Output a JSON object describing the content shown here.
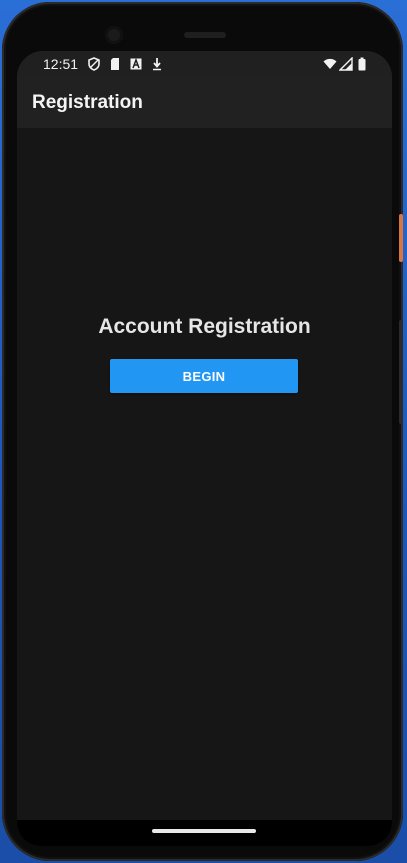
{
  "status_bar": {
    "time": "12:51",
    "left_icons": [
      "shield-icon",
      "sd-card-icon",
      "font-a-icon",
      "download-icon"
    ],
    "right_icons": [
      "wifi-icon",
      "cell-signal-icon",
      "battery-icon"
    ]
  },
  "app_bar": {
    "title": "Registration"
  },
  "main": {
    "heading": "Account Registration",
    "begin_label": "BEGIN"
  },
  "colors": {
    "accent": "#2196f3",
    "screen_background": "#161616",
    "app_bar_background": "#212121"
  }
}
